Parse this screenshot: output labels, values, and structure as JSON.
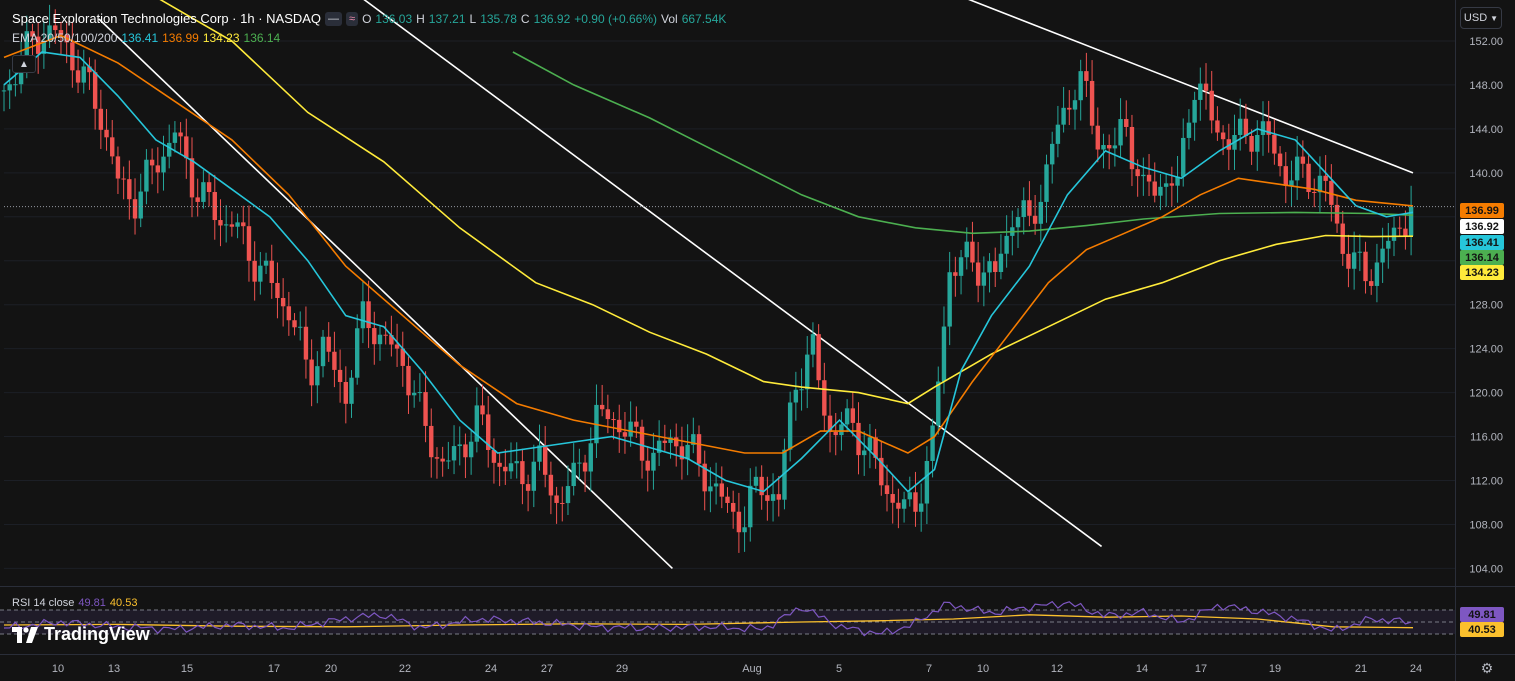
{
  "header": {
    "title": "Space Exploration Technologies Corp · 1h · NASDAQ",
    "ohlc": {
      "o_label": "O",
      "o": "136.03",
      "h_label": "H",
      "h": "137.21",
      "l_label": "L",
      "l": "135.78",
      "c_label": "C",
      "c": "136.92",
      "change": "+0.90 (+0.66%)",
      "vol_label": "Vol",
      "vol": "667.54K"
    },
    "ema_label": "EMA 20/50/100/200",
    "ema_values": [
      "136.41",
      "136.99",
      "134.23",
      "136.14"
    ]
  },
  "currency": {
    "label": "USD"
  },
  "rsi": {
    "label": "RSI 14 close",
    "value": "49.81",
    "ma_value": "40.53"
  },
  "branding": {
    "name": "TradingView"
  },
  "colors": {
    "bg": "#131313",
    "up": "#26a69a",
    "down": "#ef5350",
    "ema20": "#26c6da",
    "ema50": "#f57c00",
    "ema100": "#ffeb3b",
    "ema200": "#4caf50",
    "rsi": "#7e57c2",
    "rsi_ma": "#fbc02d",
    "trend": "#ffffff"
  },
  "chart_data": {
    "type": "candlestick",
    "y_axis": {
      "ticks": [
        104,
        108,
        112,
        116,
        120,
        124,
        128,
        132,
        136,
        140,
        144,
        148,
        152
      ],
      "tick_labels": [
        "104.00",
        "108.00",
        "112.00",
        "116.00",
        "120.00",
        "124.00",
        "128.00",
        "",
        "",
        "140.00",
        "144.00",
        "148.00",
        "152.00"
      ]
    },
    "x_axis": {
      "labels": [
        "10",
        "13",
        "15",
        "17",
        "20",
        "22",
        "24",
        "27",
        "29",
        "Aug",
        "5",
        "7",
        "10",
        "12",
        "14",
        "17",
        "19",
        "21",
        "24"
      ]
    },
    "price_tags": [
      {
        "value": "136.99",
        "series": "EMA 50",
        "color": "#f57c00",
        "y": 136.99
      },
      {
        "value": "136.92",
        "series": "last",
        "color": "#ffffff",
        "y": 136.92
      },
      {
        "value": "136.41",
        "series": "EMA 20",
        "color": "#26c6da",
        "y": 136.41
      },
      {
        "value": "136.14",
        "series": "EMA 200",
        "color": "#4caf50",
        "y": 136.14
      },
      {
        "value": "134.23",
        "series": "EMA 100",
        "color": "#ffeb3b",
        "y": 134.23
      }
    ],
    "last_close": 136.92,
    "close_path": [
      [
        0,
        147.5
      ],
      [
        10,
        150.5
      ],
      [
        20,
        153
      ],
      [
        32,
        152
      ],
      [
        40,
        149
      ],
      [
        50,
        146
      ],
      [
        60,
        139
      ],
      [
        70,
        137.5
      ],
      [
        80,
        141
      ],
      [
        90,
        143.5
      ],
      [
        100,
        139
      ],
      [
        112,
        136
      ],
      [
        120,
        135.5
      ],
      [
        130,
        132.5
      ],
      [
        140,
        130
      ],
      [
        150,
        127.5
      ],
      [
        160,
        122
      ],
      [
        168,
        124
      ],
      [
        180,
        120
      ],
      [
        190,
        127.5
      ],
      [
        198,
        125
      ],
      [
        210,
        123
      ],
      [
        220,
        117.5
      ],
      [
        232,
        113
      ],
      [
        242,
        115.5
      ],
      [
        250,
        117.5
      ],
      [
        262,
        113
      ],
      [
        272,
        112.5
      ],
      [
        282,
        113.5
      ],
      [
        292,
        110
      ],
      [
        300,
        112
      ],
      [
        312,
        117.5
      ],
      [
        320,
        118
      ],
      [
        330,
        116
      ],
      [
        342,
        114
      ],
      [
        352,
        116
      ],
      [
        362,
        114.5
      ],
      [
        370,
        112.5
      ],
      [
        380,
        109.5
      ],
      [
        390,
        108.5
      ],
      [
        398,
        112
      ],
      [
        408,
        110
      ],
      [
        416,
        121
      ],
      [
        426,
        123.5
      ],
      [
        436,
        116
      ],
      [
        446,
        117.5
      ],
      [
        454,
        115
      ],
      [
        464,
        111.5
      ],
      [
        474,
        109
      ],
      [
        482,
        111
      ],
      [
        488,
        114
      ],
      [
        498,
        131.5
      ],
      [
        510,
        132
      ],
      [
        522,
        130.5
      ],
      [
        532,
        137
      ],
      [
        540,
        135
      ],
      [
        546,
        138.5
      ],
      [
        556,
        144.5
      ],
      [
        566,
        149
      ],
      [
        574,
        144
      ],
      [
        584,
        141.5
      ],
      [
        590,
        145
      ],
      [
        600,
        138
      ],
      [
        610,
        139.5
      ],
      [
        618,
        138.5
      ],
      [
        626,
        148.5
      ],
      [
        636,
        145
      ],
      [
        646,
        142.5
      ],
      [
        656,
        144
      ],
      [
        666,
        143
      ],
      [
        676,
        139.5
      ],
      [
        686,
        140
      ],
      [
        696,
        138.5
      ],
      [
        706,
        133
      ],
      [
        716,
        130.5
      ],
      [
        726,
        132.5
      ],
      [
        736,
        135.5
      ],
      [
        742,
        136.92
      ]
    ],
    "ema20": [
      [
        0,
        148
      ],
      [
        20,
        151
      ],
      [
        40,
        150.5
      ],
      [
        60,
        147
      ],
      [
        80,
        143
      ],
      [
        100,
        141
      ],
      [
        120,
        138.5
      ],
      [
        140,
        136
      ],
      [
        160,
        132
      ],
      [
        180,
        127
      ],
      [
        200,
        126
      ],
      [
        220,
        122
      ],
      [
        240,
        117.5
      ],
      [
        260,
        114.5
      ],
      [
        280,
        115
      ],
      [
        300,
        115.5
      ],
      [
        320,
        116
      ],
      [
        340,
        115
      ],
      [
        360,
        114
      ],
      [
        380,
        112
      ],
      [
        400,
        111
      ],
      [
        420,
        114
      ],
      [
        440,
        117.5
      ],
      [
        460,
        114
      ],
      [
        476,
        111
      ],
      [
        490,
        113
      ],
      [
        504,
        122
      ],
      [
        520,
        127
      ],
      [
        540,
        131.5
      ],
      [
        560,
        138
      ],
      [
        580,
        142
      ],
      [
        600,
        140.5
      ],
      [
        620,
        139.5
      ],
      [
        640,
        142
      ],
      [
        660,
        144
      ],
      [
        680,
        143
      ],
      [
        696,
        140
      ],
      [
        712,
        137
      ],
      [
        728,
        136
      ],
      [
        742,
        136.41
      ]
    ],
    "ema50": [
      [
        0,
        150.5
      ],
      [
        30,
        152.5
      ],
      [
        60,
        150
      ],
      [
        90,
        146.5
      ],
      [
        120,
        143
      ],
      [
        150,
        138
      ],
      [
        180,
        131.5
      ],
      [
        210,
        127
      ],
      [
        240,
        122.5
      ],
      [
        270,
        119
      ],
      [
        300,
        117.5
      ],
      [
        330,
        116.5
      ],
      [
        360,
        115.5
      ],
      [
        390,
        114.5
      ],
      [
        410,
        114.5
      ],
      [
        430,
        116.5
      ],
      [
        450,
        116.5
      ],
      [
        476,
        114.5
      ],
      [
        490,
        116
      ],
      [
        510,
        121
      ],
      [
        530,
        125.5
      ],
      [
        550,
        130
      ],
      [
        570,
        133
      ],
      [
        590,
        134.5
      ],
      [
        610,
        136
      ],
      [
        630,
        138
      ],
      [
        650,
        139.5
      ],
      [
        670,
        139
      ],
      [
        690,
        138.5
      ],
      [
        712,
        137.5
      ],
      [
        742,
        136.99
      ]
    ],
    "ema100": [
      [
        80,
        156
      ],
      [
        120,
        152
      ],
      [
        160,
        145.5
      ],
      [
        200,
        141
      ],
      [
        240,
        135
      ],
      [
        280,
        130
      ],
      [
        310,
        128
      ],
      [
        340,
        125.5
      ],
      [
        370,
        123.5
      ],
      [
        400,
        121
      ],
      [
        420,
        120.5
      ],
      [
        450,
        120
      ],
      [
        476,
        119
      ],
      [
        490,
        120.5
      ],
      [
        520,
        123.5
      ],
      [
        550,
        126
      ],
      [
        580,
        128.5
      ],
      [
        610,
        130
      ],
      [
        640,
        132
      ],
      [
        670,
        133.5
      ],
      [
        696,
        134.3
      ],
      [
        720,
        134.2
      ],
      [
        742,
        134.23
      ]
    ],
    "ema200": [
      [
        268,
        151
      ],
      [
        300,
        148
      ],
      [
        340,
        145
      ],
      [
        380,
        141.5
      ],
      [
        420,
        138
      ],
      [
        450,
        136
      ],
      [
        480,
        135
      ],
      [
        510,
        134.5
      ],
      [
        540,
        134.7
      ],
      [
        570,
        135.2
      ],
      [
        600,
        135.8
      ],
      [
        640,
        136.3
      ],
      [
        680,
        136.4
      ],
      [
        720,
        136.3
      ],
      [
        742,
        136.14
      ]
    ],
    "trendlines": [
      {
        "from": [
          50,
          154
        ],
        "to": [
          352,
          104
        ]
      },
      {
        "from": [
          180,
          157
        ],
        "to": [
          578,
          106
        ]
      },
      {
        "from": [
          490,
          157
        ],
        "to": [
          742,
          140
        ]
      }
    ],
    "rsi_range": [
      0,
      100
    ],
    "rsi_levels": [
      70,
      50,
      30
    ],
    "rsi_ma_path": [
      [
        0,
        45
      ],
      [
        60,
        46
      ],
      [
        120,
        43
      ],
      [
        180,
        42
      ],
      [
        240,
        45
      ],
      [
        300,
        47
      ],
      [
        360,
        46
      ],
      [
        420,
        50
      ],
      [
        460,
        52
      ],
      [
        500,
        55
      ],
      [
        540,
        62
      ],
      [
        580,
        58
      ],
      [
        620,
        60
      ],
      [
        660,
        55
      ],
      [
        700,
        42
      ],
      [
        742,
        40.53
      ]
    ],
    "rsi_path": [
      [
        0,
        40
      ],
      [
        30,
        50
      ],
      [
        60,
        42
      ],
      [
        90,
        38
      ],
      [
        120,
        45
      ],
      [
        150,
        40
      ],
      [
        185,
        58
      ],
      [
        200,
        62
      ],
      [
        220,
        40
      ],
      [
        250,
        55
      ],
      [
        280,
        50
      ],
      [
        310,
        42
      ],
      [
        340,
        40
      ],
      [
        370,
        42
      ],
      [
        400,
        38
      ],
      [
        420,
        75
      ],
      [
        440,
        42
      ],
      [
        462,
        30
      ],
      [
        478,
        45
      ],
      [
        496,
        80
      ],
      [
        520,
        65
      ],
      [
        540,
        75
      ],
      [
        560,
        82
      ],
      [
        580,
        60
      ],
      [
        600,
        66
      ],
      [
        620,
        50
      ],
      [
        640,
        78
      ],
      [
        660,
        68
      ],
      [
        680,
        55
      ],
      [
        700,
        35
      ],
      [
        720,
        55
      ],
      [
        742,
        49.81
      ]
    ]
  }
}
